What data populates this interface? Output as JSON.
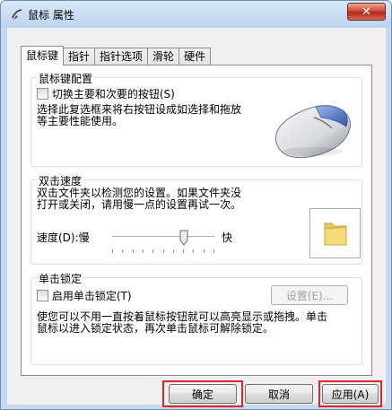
{
  "window": {
    "title": "鼠标 属性",
    "close_symbol": "✕"
  },
  "tabs": [
    {
      "label": "鼠标键",
      "active": true
    },
    {
      "label": "指针",
      "active": false
    },
    {
      "label": "指针选项",
      "active": false
    },
    {
      "label": "滑轮",
      "active": false
    },
    {
      "label": "硬件",
      "active": false
    }
  ],
  "button_config": {
    "group_label": "鼠标键配置",
    "switch_checkbox_label": "切换主要和次要的按钮(S)",
    "switch_checked": false,
    "description_line1": "选择此复选框来将右按钮设成如选择和拖放",
    "description_line2": "等主要性能使用。"
  },
  "double_click": {
    "group_label": "双击速度",
    "description_line1": "双击文件夹以检测您的设置。如果文件夹没",
    "description_line2": "打开或关闭，请用慢一点的设置再试一次。",
    "speed_label": "速度(D):慢",
    "fast_label": "快",
    "speed_level": 0.7
  },
  "click_lock": {
    "group_label": "单击锁定",
    "enable_checkbox_label": "启用单击锁定(T)",
    "enable_checked": false,
    "settings_button": "设置(E)...",
    "description_line1": "使您可以不用一直按着鼠标按钮就可以高亮显示或拖拽。单击",
    "description_line2": "鼠标以进入锁定状态，再次单击鼠标可解除锁定。"
  },
  "footer": {
    "ok": "确定",
    "cancel": "取消",
    "apply": "应用(A)"
  },
  "colors": {
    "highlight": "#e0242a"
  }
}
